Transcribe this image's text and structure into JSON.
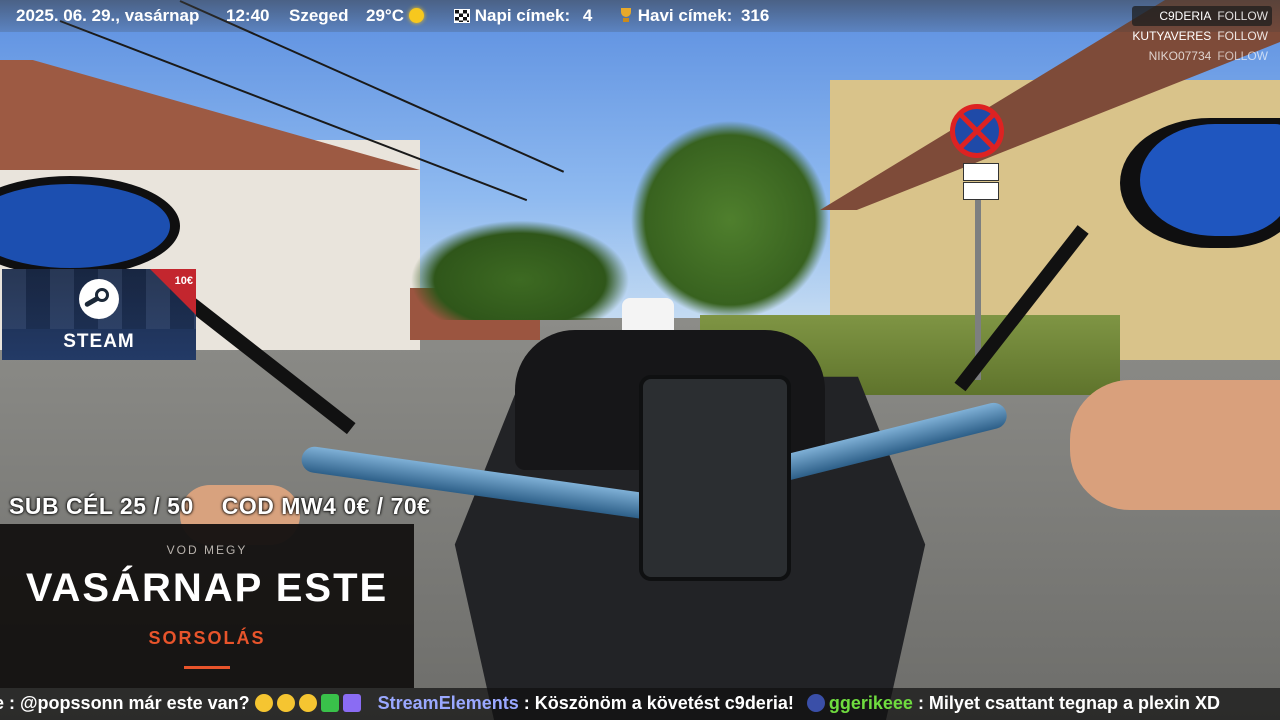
{
  "topbar": {
    "date": "2025. 06. 29., vasárnap",
    "time": "12:40",
    "city": "Szeged",
    "temperature": "29°C",
    "daily_label": "Napi címek:",
    "daily_count": "4",
    "monthly_label": "Havi címek:",
    "monthly_count": "316",
    "icons": [
      "sun-icon",
      "checkered-flag-icon",
      "trophy-icon"
    ]
  },
  "followers": [
    {
      "name": "C9DERIA",
      "action": "FOLLOW"
    },
    {
      "name": "KUTYAVERES",
      "action": "FOLLOW"
    },
    {
      "name": "NIKO07734",
      "action": "FOLLOW"
    }
  ],
  "steam_card": {
    "price": "10€",
    "name": "STEAM"
  },
  "goals": {
    "sub_goal": "SUB CÉL 25 / 50",
    "cod_goal": "COD MW4 0€ / 70€"
  },
  "vod_panel": {
    "eyebrow": "VOD MEGY",
    "title": "VASÁRNAP ESTE",
    "subtitle": "SORSOLÁS",
    "accent_color": "#e8542b"
  },
  "chat": [
    {
      "user": "",
      "text": "e : @popssonn már este van?"
    },
    {
      "user": "StreamElements",
      "text": ": Köszönöm a követést c9deria!"
    },
    {
      "user": "ggerikeee",
      "text": ": Milyet csattant tegnap a plexin XD"
    }
  ],
  "colors": {
    "streamelements_name": "#9aa8ff",
    "ggerikeee_name": "#6fdc3f",
    "steam_badge": "#c3262e"
  }
}
